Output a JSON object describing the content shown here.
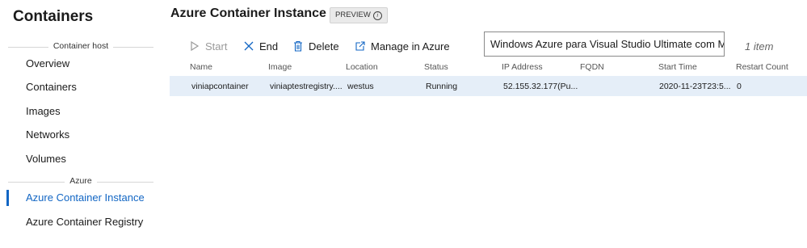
{
  "sidebar": {
    "title": "Containers",
    "sections": [
      {
        "heading": "Container host",
        "items": [
          "Overview",
          "Containers",
          "Images",
          "Networks",
          "Volumes"
        ]
      },
      {
        "heading": "Azure",
        "items": [
          "Azure Container Instance",
          "Azure Container Registry"
        ]
      }
    ],
    "active_item": "Azure Container Instance"
  },
  "header": {
    "title": "Azure Container Instance",
    "badge": "PREVIEW"
  },
  "toolbar": {
    "start_label": "Start",
    "end_label": "End",
    "delete_label": "Delete",
    "manage_label": "Manage in Azure"
  },
  "subscription": {
    "value": "Windows Azure para Visual Studio Ultimate com MSDN"
  },
  "item_count": "1 item",
  "table": {
    "columns": [
      "Name",
      "Image",
      "Location",
      "Status",
      "IP Address",
      "FQDN",
      "Start Time",
      "Restart Count"
    ],
    "rows": [
      [
        "viniapcontainer",
        "viniaptestregistry....",
        "westus",
        "Running",
        "52.155.32.177(Pu...",
        "",
        "2020-11-23T23:5...",
        "0"
      ]
    ]
  },
  "colors": {
    "accent": "#1266c4",
    "selected_row": "#e5eef8",
    "disabled_text": "#9a9a9a"
  }
}
